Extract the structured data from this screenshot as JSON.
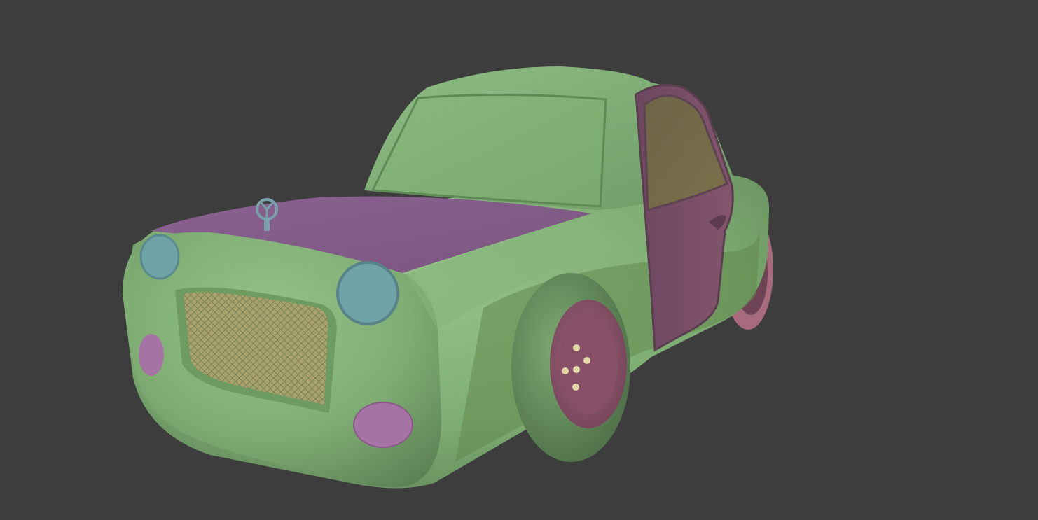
{
  "scene": {
    "background_color": "#3d3d3d",
    "subject": "car-model",
    "colors": {
      "body_green": "#7fae74",
      "body_green_dark": "#5b7f53",
      "body_green_light": "#95c28a",
      "hood_purple": "#86608a",
      "door_purple": "#7a4f66",
      "headlight_blue": "#6fa3a8",
      "foglight_pink": "#a673a5",
      "wheel_rim_pink": "#b8758a",
      "window_tint": "#74694a",
      "grille_mesh": "#b7b079",
      "lug_nut": "#e3d7a8",
      "emblem": "#7aa0ad"
    },
    "icons": {
      "emblem": "hood-ornament-icon"
    }
  }
}
